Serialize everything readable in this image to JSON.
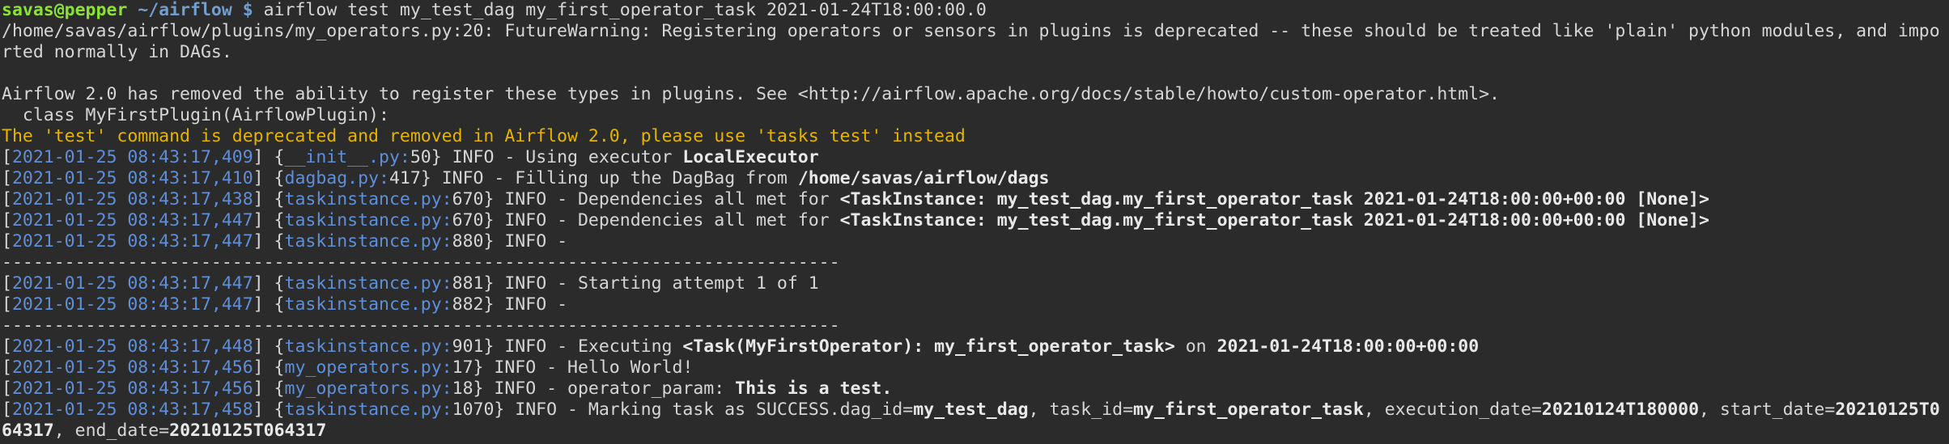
{
  "prompt": {
    "user_host": "savas@pepper",
    "cwd": "~/airflow",
    "symbol": "$",
    "command": "airflow test my_test_dag my_first_operator_task 2021-01-24T18:00:00.0"
  },
  "warning_lines": [
    "/home/savas/airflow/plugins/my_operators.py:20: FutureWarning: Registering operators or sensors in plugins is deprecated -- these should be treated like 'plain' python modules, and impo",
    "rted normally in DAGs.",
    "",
    "Airflow 2.0 has removed the ability to register these types in plugins. See <http://airflow.apache.org/docs/stable/howto/custom-operator.html>.",
    "  class MyFirstPlugin(AirflowPlugin):"
  ],
  "deprecation_notice": "The 'test' command is deprecated and removed in Airflow 2.0, please use 'tasks test' instead",
  "separator": "--------------------------------------------------------------------------------",
  "logs": [
    {
      "ts": "2021-01-25 08:43:17,409",
      "file": "__init__.py",
      "line": "50",
      "parts": [
        {
          "t": "INFO - Using executor "
        },
        {
          "t": "LocalExecutor",
          "b": true
        }
      ]
    },
    {
      "ts": "2021-01-25 08:43:17,410",
      "file": "dagbag.py",
      "line": "417",
      "parts": [
        {
          "t": "INFO - Filling up the DagBag from "
        },
        {
          "t": "/home/savas/airflow/dags",
          "b": true
        }
      ]
    },
    {
      "ts": "2021-01-25 08:43:17,438",
      "file": "taskinstance.py",
      "line": "670",
      "parts": [
        {
          "t": "INFO - Dependencies all met for "
        },
        {
          "t": "<TaskInstance: my_test_dag.my_first_operator_task 2021-01-24T18:00:00+00:00 [None]>",
          "b": true
        }
      ]
    },
    {
      "ts": "2021-01-25 08:43:17,447",
      "file": "taskinstance.py",
      "line": "670",
      "parts": [
        {
          "t": "INFO - Dependencies all met for "
        },
        {
          "t": "<TaskInstance: my_test_dag.my_first_operator_task 2021-01-24T18:00:00+00:00 [None]>",
          "b": true
        }
      ]
    },
    {
      "ts": "2021-01-25 08:43:17,447",
      "file": "taskinstance.py",
      "line": "880",
      "parts": [
        {
          "t": "INFO - "
        }
      ]
    },
    {
      "sep": true
    },
    {
      "ts": "2021-01-25 08:43:17,447",
      "file": "taskinstance.py",
      "line": "881",
      "parts": [
        {
          "t": "INFO - Starting attempt 1 of 1"
        }
      ]
    },
    {
      "ts": "2021-01-25 08:43:17,447",
      "file": "taskinstance.py",
      "line": "882",
      "parts": [
        {
          "t": "INFO - "
        }
      ]
    },
    {
      "sep": true
    },
    {
      "ts": "2021-01-25 08:43:17,448",
      "file": "taskinstance.py",
      "line": "901",
      "parts": [
        {
          "t": "INFO - Executing "
        },
        {
          "t": "<Task(MyFirstOperator): my_first_operator_task>",
          "b": true
        },
        {
          "t": " on "
        },
        {
          "t": "2021-01-24T18:00:00+00:00",
          "b": true
        }
      ]
    },
    {
      "ts": "2021-01-25 08:43:17,456",
      "file": "my_operators.py",
      "line": "17",
      "parts": [
        {
          "t": "INFO - Hello World!"
        }
      ]
    },
    {
      "ts": "2021-01-25 08:43:17,456",
      "file": "my_operators.py",
      "line": "18",
      "parts": [
        {
          "t": "INFO - operator_param: "
        },
        {
          "t": "This is a test.",
          "b": true
        }
      ]
    },
    {
      "ts": "2021-01-25 08:43:17,458",
      "file": "taskinstance.py",
      "line": "1070",
      "parts": [
        {
          "t": "INFO - Marking task as SUCCESS.dag_id="
        },
        {
          "t": "my_test_dag",
          "b": true
        },
        {
          "t": ", task_id="
        },
        {
          "t": "my_first_operator_task",
          "b": true
        },
        {
          "t": ", execution_date="
        },
        {
          "t": "20210124T180000",
          "b": true
        },
        {
          "t": ", start_date="
        },
        {
          "t": "20210125T0",
          "b": true
        }
      ]
    }
  ],
  "wrap_tail": [
    {
      "t": "64317",
      "b": true
    },
    {
      "t": ", end_date="
    },
    {
      "t": "20210125T064317",
      "b": true
    }
  ]
}
